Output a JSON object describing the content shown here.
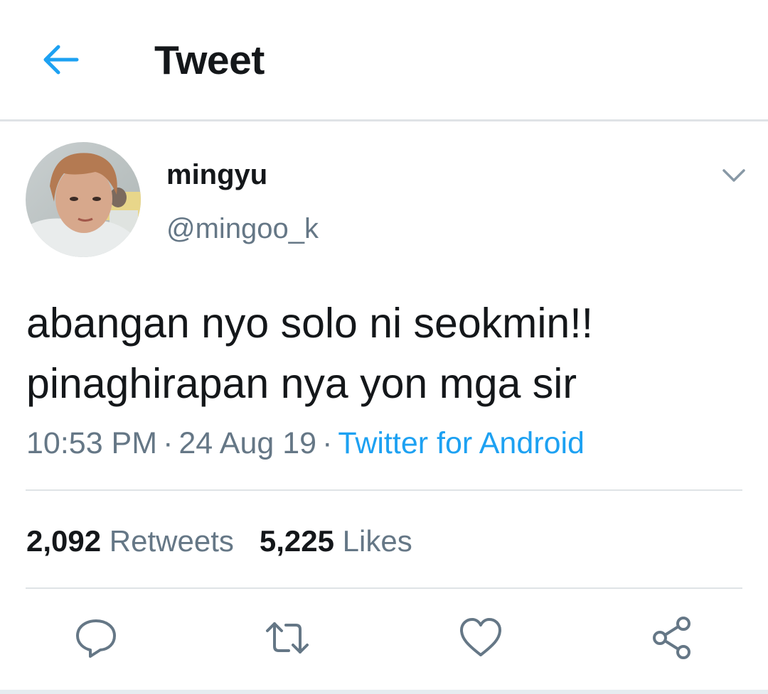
{
  "header": {
    "title": "Tweet",
    "back_icon": "arrow-left-icon",
    "accent_color": "#1da1f2"
  },
  "tweet": {
    "author": {
      "display_name": "mingyu",
      "handle": "@mingoo_k"
    },
    "text_lines": [
      "abangan nyo solo ni seokmin!!",
      "pinaghirapan nya yon mga sir"
    ],
    "time": "10:53 PM",
    "date": "24 Aug 19",
    "separator": "·",
    "source": "Twitter for Android",
    "stats": {
      "retweets_count": "2,092",
      "retweets_label": "Retweets",
      "likes_count": "5,225",
      "likes_label": "Likes"
    },
    "actions": [
      "reply-icon",
      "retweet-icon",
      "like-icon",
      "share-icon"
    ]
  },
  "colors": {
    "text_primary": "#14171a",
    "text_secondary": "#657786",
    "link": "#1da1f2",
    "divider": "#dfe3e6"
  }
}
